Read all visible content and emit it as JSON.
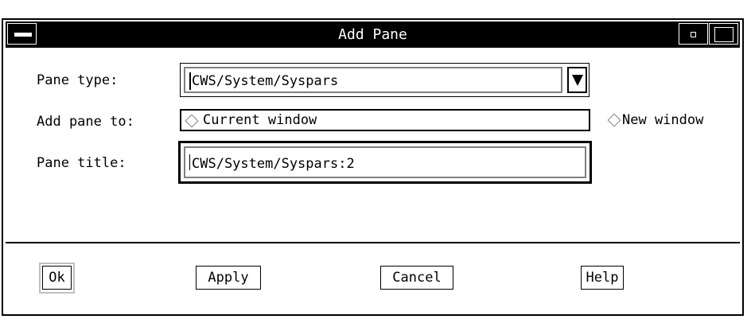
{
  "window": {
    "title": "Add Pane"
  },
  "form": {
    "pane_type": {
      "label": "Pane type:",
      "value": "CWS/System/Syspars"
    },
    "add_pane_to": {
      "label": "Add pane to:",
      "options": [
        "Current window",
        "New window"
      ]
    },
    "pane_title": {
      "label": "Pane title:",
      "value": "CWS/System/Syspars:2"
    }
  },
  "buttons": {
    "ok": "Ok",
    "apply": "Apply",
    "cancel": "Cancel",
    "help": "Help"
  },
  "icons": {
    "window_menu": "window-menu-icon",
    "minimize": "minimize-icon",
    "maximize": "maximize-icon",
    "dropdown": "dropdown-arrow-icon"
  }
}
